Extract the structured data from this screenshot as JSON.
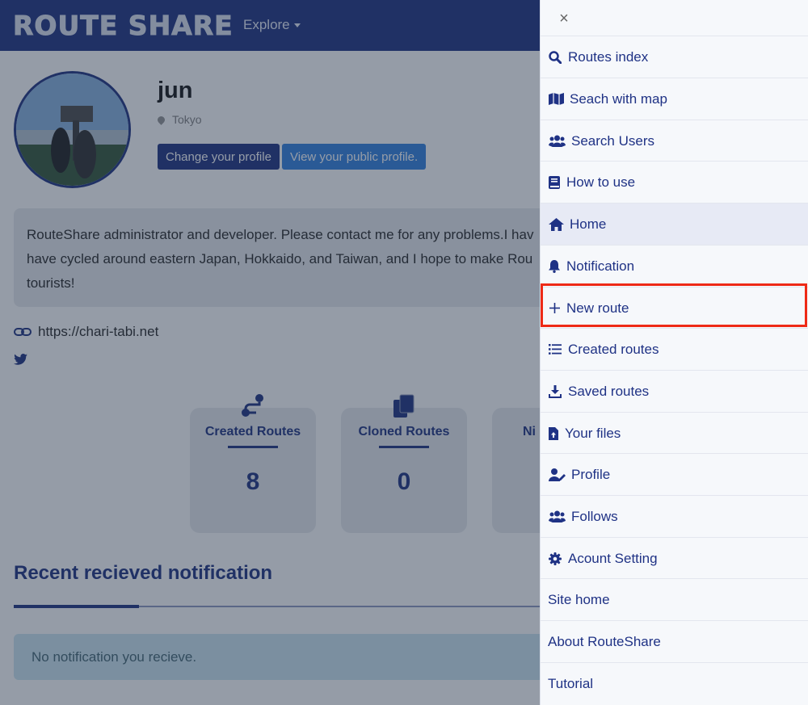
{
  "navbar": {
    "brand": "ROUTE SHARE",
    "explore_label": "Explore"
  },
  "profile": {
    "username": "jun",
    "location": "Tokyo",
    "change_profile_button": "Change your profile",
    "public_profile_button": "View your public profile.",
    "bio_lines": [
      "RouteShare administrator and developer. Please contact me for any problems.I hav",
      "have cycled around eastern Japan, Hokkaido, and Taiwan, and I hope to make Rou",
      "tourists!"
    ],
    "website": "https://chari-tabi.net"
  },
  "stats": [
    {
      "label": "Created Routes",
      "value": "8",
      "icon": "route-icon"
    },
    {
      "label": "Cloned Routes",
      "value": "0",
      "icon": "copy-icon"
    },
    {
      "label": "Ni",
      "value": "",
      "icon": ""
    }
  ],
  "notifications": {
    "title": "Recent recieved notification",
    "empty_message": "No notification you recieve."
  },
  "menu": {
    "close_label": "×",
    "items": [
      {
        "label": "Routes index",
        "icon": "search-icon"
      },
      {
        "label": "Seach with map",
        "icon": "map-icon"
      },
      {
        "label": "Search Users",
        "icon": "users-icon"
      },
      {
        "label": "How to use",
        "icon": "book-icon"
      },
      {
        "label": "Home",
        "icon": "home-icon"
      },
      {
        "label": "Notification",
        "icon": "bell-icon"
      },
      {
        "label": "New route",
        "icon": "plus-icon"
      },
      {
        "label": "Created routes",
        "icon": "list-icon"
      },
      {
        "label": "Saved routes",
        "icon": "download-icon"
      },
      {
        "label": "Your files",
        "icon": "file-upload-icon"
      },
      {
        "label": "Profile",
        "icon": "user-edit-icon"
      },
      {
        "label": "Follows",
        "icon": "users-icon"
      },
      {
        "label": "Acount Setting",
        "icon": "gear-icon"
      },
      {
        "label": "Site home",
        "icon": ""
      },
      {
        "label": "About RouteShare",
        "icon": ""
      },
      {
        "label": "Tutorial",
        "icon": ""
      }
    ]
  },
  "colors": {
    "brand": "#2a3d87",
    "highlight": "#ee2a16",
    "menu_text": "#1f3285"
  }
}
